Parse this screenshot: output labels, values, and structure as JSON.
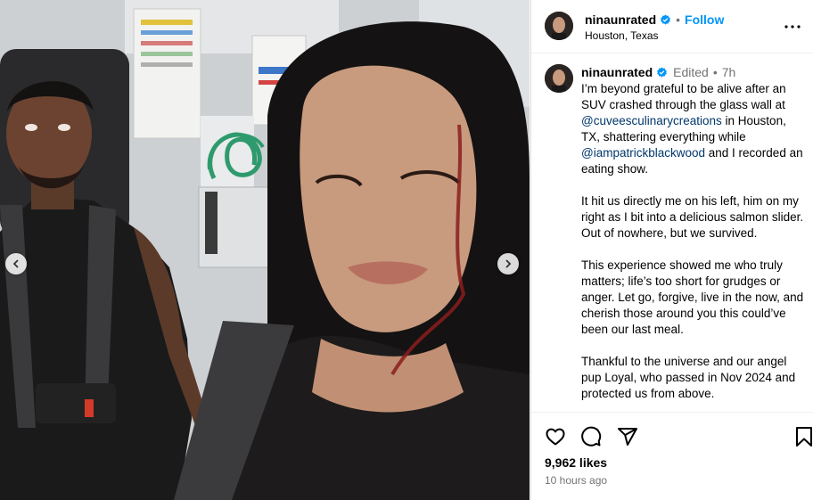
{
  "post": {
    "username": "ninaunrated",
    "follow_label": "Follow",
    "location": "Houston, Texas",
    "separator": "•"
  },
  "caption": {
    "username": "ninaunrated",
    "edited_label": "Edited",
    "age": "7h",
    "p1_a": "I’m beyond grateful to be alive after an SUV crashed through the glass wall at ",
    "p1_mention1": "@cuveesculinarycreations",
    "p1_b": " in Houston, TX, shattering everything while ",
    "p1_mention2": "@iampatrickblackwood",
    "p1_c": " and I recorded an eating show.",
    "p2": "It hit us directly me on his left, him on my right as I bit into a delicious salmon slider. Out of nowhere, but we survived.",
    "p3": "This experience showed me who truly matters; life’s too short for grudges or anger. Let go, forgive, live in the now, and cherish those around you this could’ve been our last meal.",
    "p4": "Thankful to the universe and our angel pup Loyal, who passed in Nov 2024 and protected us from above."
  },
  "footer": {
    "likes": "9,962 likes",
    "time": "10 hours ago"
  },
  "icons": {
    "verified": "verified-badge-icon",
    "more": "more-options-icon",
    "like": "heart-icon",
    "comment": "comment-icon",
    "share": "send-icon",
    "save": "bookmark-icon",
    "prev": "chevron-left-icon",
    "next": "chevron-right-icon"
  },
  "colors": {
    "accent": "#0095f6",
    "verified": "#0095f6",
    "mention": "#00376b",
    "secondary_text": "#737373"
  }
}
